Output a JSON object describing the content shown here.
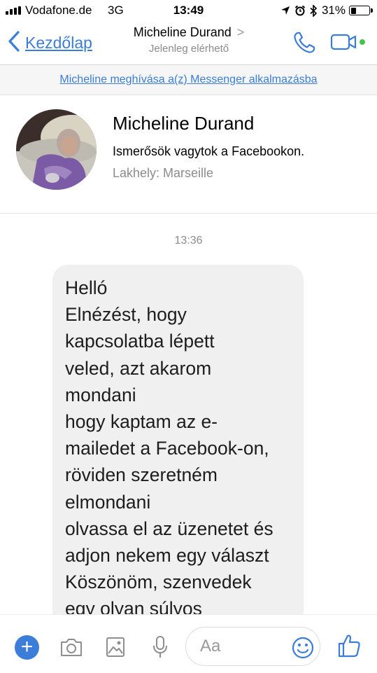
{
  "status_bar": {
    "carrier": "Vodafone.de",
    "network": "3G",
    "time": "13:49",
    "battery_pct": "31%",
    "battery_level": 0.31,
    "icons": [
      "signal-icon",
      "location-arrow-icon",
      "alarm-icon",
      "bluetooth-icon",
      "battery-icon"
    ]
  },
  "nav": {
    "back_label": "Kezdőlap",
    "title": "Micheline Durand",
    "chevron": ">",
    "subtitle": "Jelenleg elérhető",
    "accent_color": "#3b7dd8",
    "online_color": "#44c44a"
  },
  "banner": {
    "invite_text": "Micheline meghívása a(z) Messenger alkalmazásba"
  },
  "profile": {
    "name": "Micheline Durand",
    "relationship": "Ismerősök vagytok a Facebookon.",
    "location": "Lakhely: Marseille"
  },
  "thread": {
    "timestamp": "13:36",
    "messages": [
      {
        "sender": "Micheline Durand",
        "text": "Helló\nElnézést, hogy\nkapcsolatba lépett\nveled, azt akarom\nmondani\nhogy kaptam az e-\nmailedet a Facebook-on,\nröviden szeretném\nelmondani\nolvassa el az üzenetet és\nadjon nekem egy választ\nKöszönöm, szenvedek\negy olyan súlyos"
      }
    ]
  },
  "composer": {
    "placeholder": "Aa",
    "plus_label": "+",
    "icons": [
      "plus-icon",
      "camera-icon",
      "gallery-icon",
      "microphone-icon",
      "emoji-icon",
      "thumbs-up-icon"
    ]
  }
}
